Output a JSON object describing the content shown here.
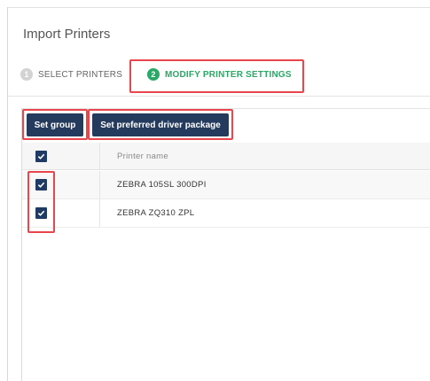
{
  "window": {
    "title": "Import Printers"
  },
  "steps": [
    {
      "number": "1",
      "label": "SELECT PRINTERS",
      "state": "inactive"
    },
    {
      "number": "2",
      "label": "MODIFY PRINTER SETTINGS",
      "state": "active"
    }
  ],
  "toolbar": {
    "set_group_label": "Set group",
    "set_driver_label": "Set preferred driver package"
  },
  "table": {
    "columns": [
      "",
      "Printer name"
    ],
    "header_checked": true,
    "rows": [
      {
        "checked": true,
        "name": "ZEBRA 105SL 300DPI"
      },
      {
        "checked": true,
        "name": "ZEBRA ZQ310 ZPL"
      }
    ]
  },
  "colors": {
    "accent_green": "#2aa865",
    "button_navy": "#243b5e",
    "highlight_red": "#e8454d"
  }
}
